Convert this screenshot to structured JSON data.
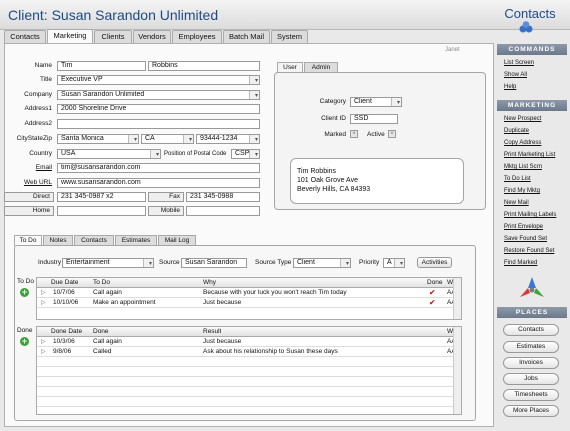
{
  "header": {
    "title": "Client: Susan Sarandon Unlimited",
    "right_title": "Contacts"
  },
  "top_tabs": [
    {
      "label": "Contacts"
    },
    {
      "label": "Marketing"
    },
    {
      "label": "Clients"
    },
    {
      "label": "Vendors"
    },
    {
      "label": "Employees"
    },
    {
      "label": "Batch Mail"
    },
    {
      "label": "System"
    }
  ],
  "user_tag": "Janet",
  "form": {
    "name_label": "Name",
    "first_name": "Tim",
    "last_name": "Robbins",
    "title_label": "Title",
    "title": "Executive VP",
    "company_label": "Company",
    "company": "Susan Sarandon Unlimited",
    "address1_label": "Address1",
    "address1": "2000 Shoreline Drive",
    "address2_label": "Address2",
    "address2": "",
    "csz_label": "CityStateZip",
    "city": "Santa Monica",
    "state": "CA",
    "zip": "93444-1234",
    "country_label": "Country",
    "country": "USA",
    "postal_pos_label": "Position of Postal Code",
    "postal_pos": "CSP",
    "email_label": "Email",
    "email": "tim@susansarandon.com",
    "web_label": "Web URL",
    "web": "www.susansarandon.com",
    "direct_label": "Direct",
    "direct": "231 345-0987 x2",
    "fax_label": "Fax",
    "fax": "231 345-0988",
    "home_label": "Home",
    "home": "",
    "mobile_label": "Mobile",
    "mobile": ""
  },
  "user_box": {
    "tabs": [
      {
        "label": "User"
      },
      {
        "label": "Admin"
      }
    ],
    "category_label": "Category",
    "category": "Client",
    "client_id_label": "Client ID",
    "client_id": "SSD",
    "marked_label": "Marked",
    "active_label": "Active",
    "check_mark": "×",
    "address_lines": [
      "Tim Robbins",
      "101 Oak Grove Ave",
      "Beverly Hills, CA  84393"
    ]
  },
  "bottom_tabs": [
    {
      "label": "To Do"
    },
    {
      "label": "Notes"
    },
    {
      "label": "Contacts"
    },
    {
      "label": "Estimates"
    },
    {
      "label": "Mail Log"
    }
  ],
  "filter": {
    "industry_label": "Industry",
    "industry": "Entertainment",
    "source_label": "Source",
    "source": "Susan Sarandon",
    "source_type_label": "Source Type",
    "source_type": "Client",
    "priority_label": "Priority",
    "priority": "A",
    "activities_label": "Activities"
  },
  "todo": {
    "side_label": "To Do",
    "columns": [
      "Due Date",
      "To Do",
      "Why",
      "Done",
      "Who"
    ],
    "rows": [
      {
        "date": "10/7/06",
        "task": "Call again",
        "why": "Because with your luck you won't reach Tim today",
        "done": "✔",
        "who": "AA"
      },
      {
        "date": "10/10/06",
        "task": "Make an appointment",
        "why": "Just because",
        "done": "✔",
        "who": "AA"
      }
    ]
  },
  "done": {
    "side_label": "Done",
    "columns": [
      "Done Date",
      "Done",
      "Result",
      "Who"
    ],
    "rows": [
      {
        "date": "10/3/06",
        "task": "Call again",
        "result": "Just because",
        "who": "AA"
      },
      {
        "date": "9/8/06",
        "task": "Called",
        "result": "Ask about his relationship to Susan these days",
        "who": "AA"
      }
    ]
  },
  "commands": {
    "heading": "COMMANDS",
    "items": [
      {
        "label": "List Screen"
      },
      {
        "label": "Show All"
      },
      {
        "label": "Help"
      }
    ]
  },
  "marketing": {
    "heading": "MARKETING",
    "items": [
      {
        "label": "New Prospect"
      },
      {
        "label": "Duplicate"
      },
      {
        "label": "Copy Address"
      },
      {
        "label": "Print Marketing List"
      },
      {
        "label": "Mktg List Scrn"
      },
      {
        "label": "To Do List"
      },
      {
        "label": "Find My Mktg"
      },
      {
        "label": "New Mail"
      },
      {
        "label": "Print Mailing Labels"
      },
      {
        "label": "Print Envelope"
      },
      {
        "label": "Save Found Set"
      },
      {
        "label": "Restore Found Set"
      },
      {
        "label": "Find Marked"
      }
    ]
  },
  "places": {
    "heading": "PLACES",
    "items": [
      {
        "label": "Contacts"
      },
      {
        "label": "Estimates"
      },
      {
        "label": "Invoices"
      },
      {
        "label": "Jobs"
      },
      {
        "label": "Timesheets"
      },
      {
        "label": "More Places"
      }
    ]
  },
  "colors": {
    "title_blue": "#1e4b86",
    "green": "#37a337",
    "check_red": "#cc1111"
  }
}
